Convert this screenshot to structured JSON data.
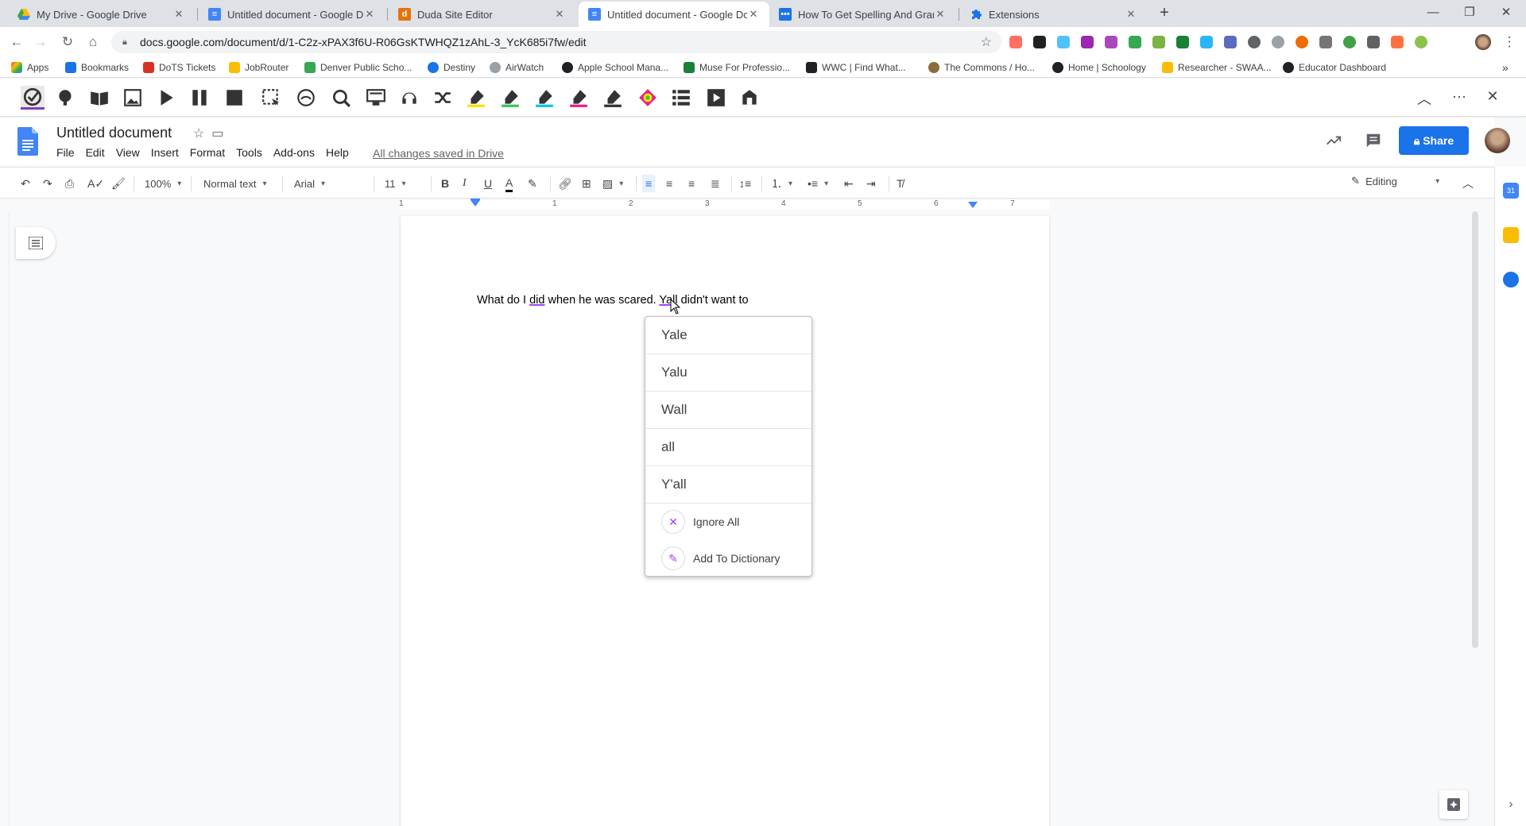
{
  "tabs": [
    {
      "title": "My Drive - Google Drive",
      "favicon_color": "#34a853"
    },
    {
      "title": "Untitled document - Google Doc",
      "favicon_color": "#4285f4"
    },
    {
      "title": "Duda Site Editor",
      "favicon_color": "#e8710a",
      "favicon_letter": "d"
    },
    {
      "title": "Untitled document - Google Doc",
      "favicon_color": "#4285f4",
      "active": true
    },
    {
      "title": "How To Get Spelling And Gramm",
      "favicon_color": "#1a73e8"
    },
    {
      "title": "Extensions",
      "favicon_color": "#1a73e8"
    }
  ],
  "address": {
    "url": "docs.google.com/document/d/1-C2z-xPAX3f6U-R06GsKTWHQZ1zAhL-3_YcK685i7fw/edit"
  },
  "bookmarks": [
    {
      "label": "Apps",
      "color": "#ea4335"
    },
    {
      "label": "Bookmarks",
      "color": "#1a73e8"
    },
    {
      "label": "DoTS Tickets",
      "color": "#d93025"
    },
    {
      "label": "JobRouter",
      "color": "#fbbc04"
    },
    {
      "label": "Denver Public Scho...",
      "color": "#34a853"
    },
    {
      "label": "Destiny",
      "color": "#1a73e8"
    },
    {
      "label": "AirWatch",
      "color": "#5f6368"
    },
    {
      "label": "Apple School Mana...",
      "color": "#202124"
    },
    {
      "label": "Muse For Professio...",
      "color": "#188038"
    },
    {
      "label": "WWC | Find What...",
      "color": "#202124"
    },
    {
      "label": "The Commons / Ho...",
      "color": "#8a6d3b"
    },
    {
      "label": "Home | Schoology",
      "color": "#202124"
    },
    {
      "label": "Researcher - SWAA...",
      "color": "#fbbc04"
    },
    {
      "label": "Educator Dashboard",
      "color": "#202124"
    }
  ],
  "doc": {
    "title": "Untitled document",
    "menus": [
      "File",
      "Edit",
      "View",
      "Insert",
      "Format",
      "Tools",
      "Add-ons",
      "Help"
    ],
    "saved_status": "All changes saved in Drive",
    "share_label": "Share"
  },
  "format": {
    "zoom": "100%",
    "style": "Normal text",
    "font": "Arial",
    "size": "11",
    "mode": "Editing"
  },
  "ruler_numbers": [
    "1",
    "1",
    "2",
    "3",
    "4",
    "5",
    "6",
    "7"
  ],
  "body": {
    "t1": "What do I ",
    "w1": "did",
    "t2": " when he was scared. ",
    "w2": "Yall",
    "t3": " didn't want to"
  },
  "suggestions": [
    "Yale",
    "Yalu",
    "Wall",
    "all",
    "Y'all"
  ],
  "actions": {
    "ignore": "Ignore All",
    "add": "Add To Dictionary"
  },
  "colors": {
    "accent": "#1a73e8",
    "spell": "#a142f4"
  }
}
